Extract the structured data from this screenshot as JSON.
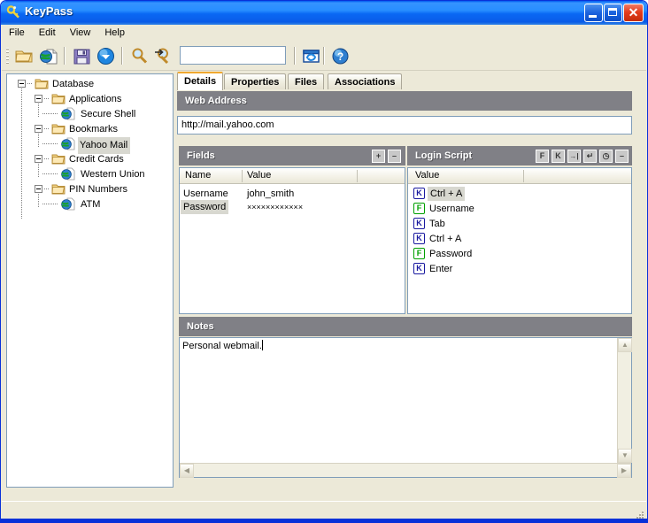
{
  "window": {
    "title": "KeyPass",
    "icon": "key-icon",
    "buttons": {
      "minimize": "_",
      "maximize": "□",
      "close": "✕"
    }
  },
  "menu": {
    "items": [
      {
        "label": "File"
      },
      {
        "label": "Edit"
      },
      {
        "label": "View"
      },
      {
        "label": "Help"
      }
    ]
  },
  "toolbar": {
    "buttons": [
      {
        "name": "open-folder-icon",
        "title": "Open"
      },
      {
        "name": "new-entry-icon",
        "title": "New Entry"
      },
      {
        "name": "save-icon",
        "title": "Save"
      },
      {
        "name": "run-icon",
        "title": "Run"
      },
      {
        "name": "search-icon",
        "title": "Find"
      },
      {
        "name": "search-next-icon",
        "title": "Find Next"
      }
    ],
    "search": {
      "value": "",
      "placeholder": ""
    },
    "right_buttons": [
      {
        "name": "refresh-window-icon",
        "title": "Refresh"
      },
      {
        "name": "help-icon",
        "title": "Help"
      }
    ]
  },
  "tree": {
    "nodes": [
      {
        "label": "Database",
        "icon": "folder-icon",
        "level": 0,
        "expanded": true,
        "selected": false
      },
      {
        "label": "Applications",
        "icon": "folder-icon",
        "level": 1,
        "expanded": true,
        "selected": false
      },
      {
        "label": "Secure Shell",
        "icon": "globe-icon",
        "level": 2,
        "expanded": null,
        "selected": false
      },
      {
        "label": "Bookmarks",
        "icon": "folder-icon",
        "level": 1,
        "expanded": true,
        "selected": false
      },
      {
        "label": "Yahoo Mail",
        "icon": "globe-icon",
        "level": 2,
        "expanded": null,
        "selected": true
      },
      {
        "label": "Credit Cards",
        "icon": "folder-icon",
        "level": 1,
        "expanded": true,
        "selected": false
      },
      {
        "label": "Western Union",
        "icon": "globe-icon",
        "level": 2,
        "expanded": null,
        "selected": false
      },
      {
        "label": "PIN Numbers",
        "icon": "folder-icon",
        "level": 1,
        "expanded": true,
        "selected": false
      },
      {
        "label": "ATM",
        "icon": "globe-icon",
        "level": 2,
        "expanded": null,
        "selected": false
      }
    ]
  },
  "tabs": [
    {
      "label": "Details",
      "active": true
    },
    {
      "label": "Properties",
      "active": false
    },
    {
      "label": "Files",
      "active": false
    },
    {
      "label": "Associations",
      "active": false
    }
  ],
  "web_address": {
    "header": "Web Address",
    "value": "http://mail.yahoo.com"
  },
  "fields": {
    "header": "Fields",
    "buttons": [
      {
        "name": "add-field-button",
        "glyph": "+"
      },
      {
        "name": "remove-field-button",
        "glyph": "–"
      }
    ],
    "columns": [
      "Name",
      "Value"
    ],
    "rows": [
      {
        "name": "Username",
        "value": "john_smith",
        "selected": false
      },
      {
        "name": "Password",
        "value": "××××××××××××",
        "selected": true
      }
    ]
  },
  "login_script": {
    "header": "Login Script",
    "buttons": [
      {
        "name": "add-field-action-button",
        "glyph": "F"
      },
      {
        "name": "add-key-action-button",
        "glyph": "K"
      },
      {
        "name": "add-tab-action-button",
        "glyph": "→|"
      },
      {
        "name": "add-enter-action-button",
        "glyph": "↵"
      },
      {
        "name": "add-delay-action-button",
        "glyph": "◷"
      },
      {
        "name": "remove-action-button",
        "glyph": "–"
      }
    ],
    "columns": [
      "Value"
    ],
    "rows": [
      {
        "badge": "K",
        "value": "Ctrl + A",
        "selected": true
      },
      {
        "badge": "F",
        "value": "Username",
        "selected": false
      },
      {
        "badge": "K",
        "value": "Tab",
        "selected": false
      },
      {
        "badge": "K",
        "value": "Ctrl + A",
        "selected": false
      },
      {
        "badge": "F",
        "value": "Password",
        "selected": false
      },
      {
        "badge": "K",
        "value": "Enter",
        "selected": false
      }
    ]
  },
  "notes": {
    "header": "Notes",
    "value": "Personal webmail."
  },
  "statusbar": {
    "text": ""
  },
  "colors": {
    "title_blue": "#0a5ce8",
    "panel_header_gray": "#808086",
    "active_tab_accent": "#f0a830",
    "selection_gray": "#d8d8d0",
    "badge_key_blue": "#1919a0",
    "badge_field_green": "#00a000",
    "window_face": "#ece9d8"
  }
}
